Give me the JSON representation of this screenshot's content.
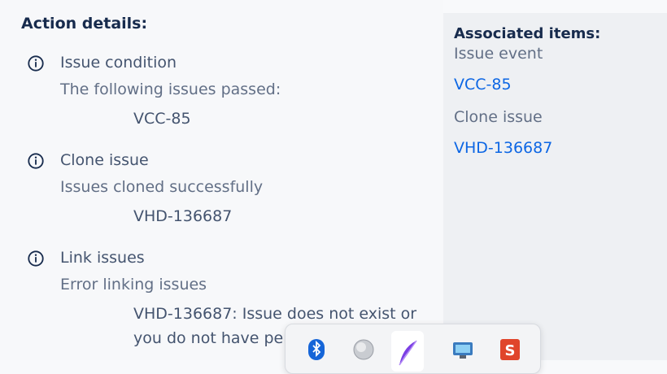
{
  "action_details": {
    "title": "Action details:",
    "items": [
      {
        "icon": "info-icon",
        "title": "Issue condition",
        "subtitle": "The following issues passed:",
        "value": "VCC-85"
      },
      {
        "icon": "info-icon",
        "title": "Clone issue",
        "subtitle": "Issues cloned successfully",
        "value": "VHD-136687"
      },
      {
        "icon": "info-icon",
        "title": "Link issues",
        "subtitle": "Error linking issues",
        "value": "VHD-136687: Issue does not exist or you do not have per"
      }
    ]
  },
  "associated_items": {
    "title": "Associated items:",
    "issue_event_label": "Issue event",
    "issue_event_link": "VCC-85",
    "clone_issue_label": "Clone issue",
    "clone_issue_link": "VHD-136687"
  },
  "taskbar": {
    "icons": [
      "bluetooth-icon",
      "globe-icon",
      "feather-pen-icon",
      "remote-desktop-icon",
      "app-s-icon"
    ],
    "colors": {
      "bluetooth": "#1565d8",
      "feather": "#7b3fe4",
      "app_s": "#e0452b"
    }
  },
  "colors": {
    "link": "#0c66e4",
    "heading": "#172b4d",
    "panel": "#eef0f3"
  }
}
